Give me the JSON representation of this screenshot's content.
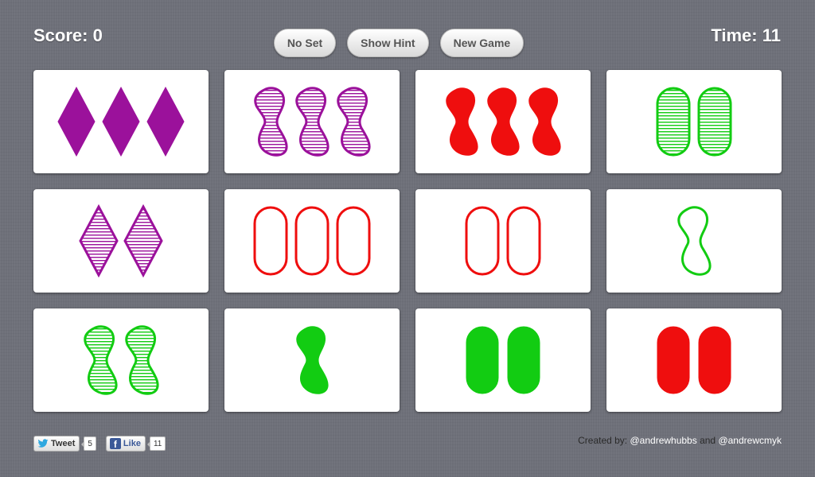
{
  "header": {
    "score_label": "Score: 0",
    "time_label": "Time: 11"
  },
  "buttons": {
    "no_set": "No Set",
    "show_hint": "Show Hint",
    "new_game": "New Game"
  },
  "colors": {
    "purple": "#9b119b",
    "red": "#ef0e0e",
    "green": "#12cc12",
    "background": "#6e7079"
  },
  "cards": [
    {
      "count": 3,
      "shape": "diamond",
      "color": "purple",
      "fill": "solid"
    },
    {
      "count": 3,
      "shape": "squiggle",
      "color": "purple",
      "fill": "striped"
    },
    {
      "count": 3,
      "shape": "squiggle",
      "color": "red",
      "fill": "solid"
    },
    {
      "count": 2,
      "shape": "oval",
      "color": "green",
      "fill": "striped"
    },
    {
      "count": 2,
      "shape": "diamond",
      "color": "purple",
      "fill": "striped"
    },
    {
      "count": 3,
      "shape": "oval",
      "color": "red",
      "fill": "open"
    },
    {
      "count": 2,
      "shape": "oval",
      "color": "red",
      "fill": "open"
    },
    {
      "count": 1,
      "shape": "squiggle",
      "color": "green",
      "fill": "open"
    },
    {
      "count": 2,
      "shape": "squiggle",
      "color": "green",
      "fill": "striped"
    },
    {
      "count": 1,
      "shape": "squiggle",
      "color": "green",
      "fill": "solid"
    },
    {
      "count": 2,
      "shape": "oval",
      "color": "green",
      "fill": "solid"
    },
    {
      "count": 2,
      "shape": "oval",
      "color": "red",
      "fill": "solid"
    }
  ],
  "social": {
    "tweet_label": "Tweet",
    "tweet_count": "5",
    "like_label": "Like",
    "like_count": "11",
    "twitter_icon": "twitter-bird-icon",
    "facebook_icon": "facebook-f-icon"
  },
  "credits": {
    "prefix": "Created by:",
    "author1": "@andrewhubbs",
    "joiner": "and",
    "author2": "@andrewcmyk"
  }
}
